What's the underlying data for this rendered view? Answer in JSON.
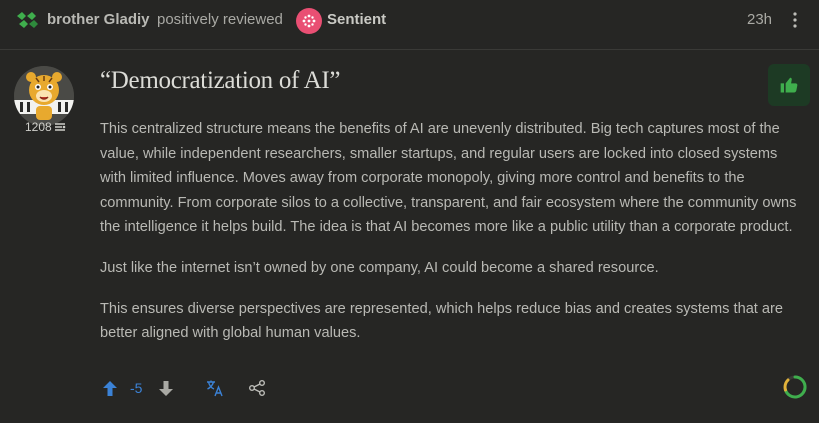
{
  "header": {
    "user_name": "brother Gladiy",
    "action_text": "positively reviewed",
    "project_name": "Sentient",
    "timestamp": "23h"
  },
  "author": {
    "karma": "1208"
  },
  "post": {
    "title": "“Democratization of AI”",
    "paragraphs": [
      "This centralized structure means the benefits of AI are unevenly distributed. Big tech captures most of the value, while independent researchers, smaller startups, and regular users are locked into closed systems with limited influence. Moves away from corporate monopoly, giving more control and benefits to the community. From corporate silos to a collective, transparent, and fair ecosystem where the community owns the intelligence it helps build. The idea is that AI becomes more like a public utility than a corporate product.",
      "Just like the internet isn’t owned by one company, AI could become a shared resource.",
      "This ensures diverse perspectives are represented, which helps reduce bias and creates systems that are better aligned with global human values."
    ]
  },
  "votes": {
    "score": "-5"
  },
  "colors": {
    "background": "#262624",
    "accent_green": "#3fae4d",
    "vote_blue": "#3b82d6",
    "project_pink": "#e94f73"
  },
  "icons": {
    "brand": "logo-icon",
    "menu": "kebab-menu-icon",
    "like": "thumbs-up-icon",
    "upvote": "arrow-up-icon",
    "downvote": "arrow-down-icon",
    "translate": "translate-icon",
    "share": "share-icon",
    "status": "loading-spinner-icon"
  }
}
